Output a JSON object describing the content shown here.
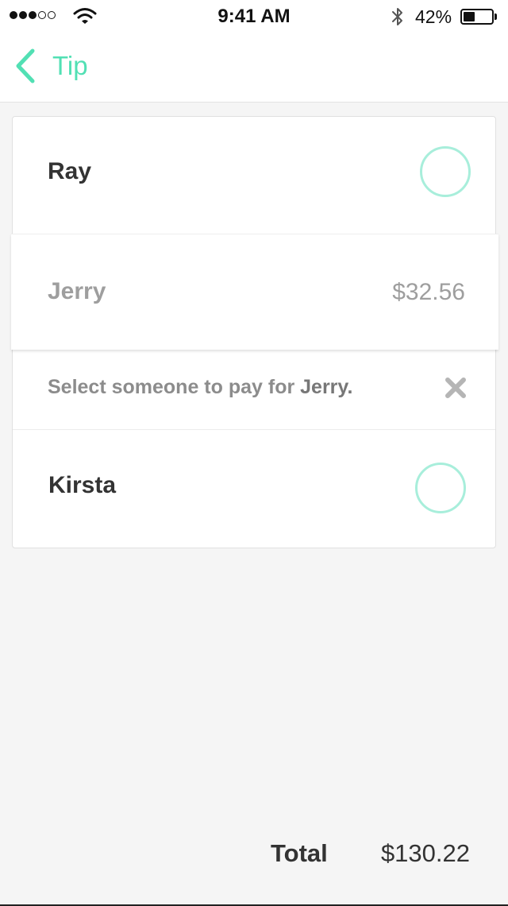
{
  "status_bar": {
    "signal_bars_filled": 3,
    "signal_bars_total": 5,
    "time": "9:41 AM",
    "battery_percent": "42%",
    "battery_level": 0.42,
    "icons": [
      "signal-dots",
      "wifi-icon",
      "bluetooth-icon",
      "battery-icon"
    ]
  },
  "nav": {
    "back_icon": "chevron-left-icon",
    "title": "Tip"
  },
  "people": {
    "ray": {
      "name": "Ray"
    },
    "jerry": {
      "name": "Jerry",
      "amount": "$32.56"
    },
    "kirsta": {
      "name": "Kirsta"
    }
  },
  "prompt": {
    "text_before": "Select someone to pay for ",
    "highlight": "Jerry.",
    "dismiss_icon": "close-x-icon"
  },
  "footer": {
    "total_label": "Total",
    "total_value": "$130.22"
  },
  "colors": {
    "accent": "#52e0b4",
    "circle_border": "#a8eedb",
    "background": "#f5f5f5",
    "muted_text": "#9e9e9e"
  }
}
